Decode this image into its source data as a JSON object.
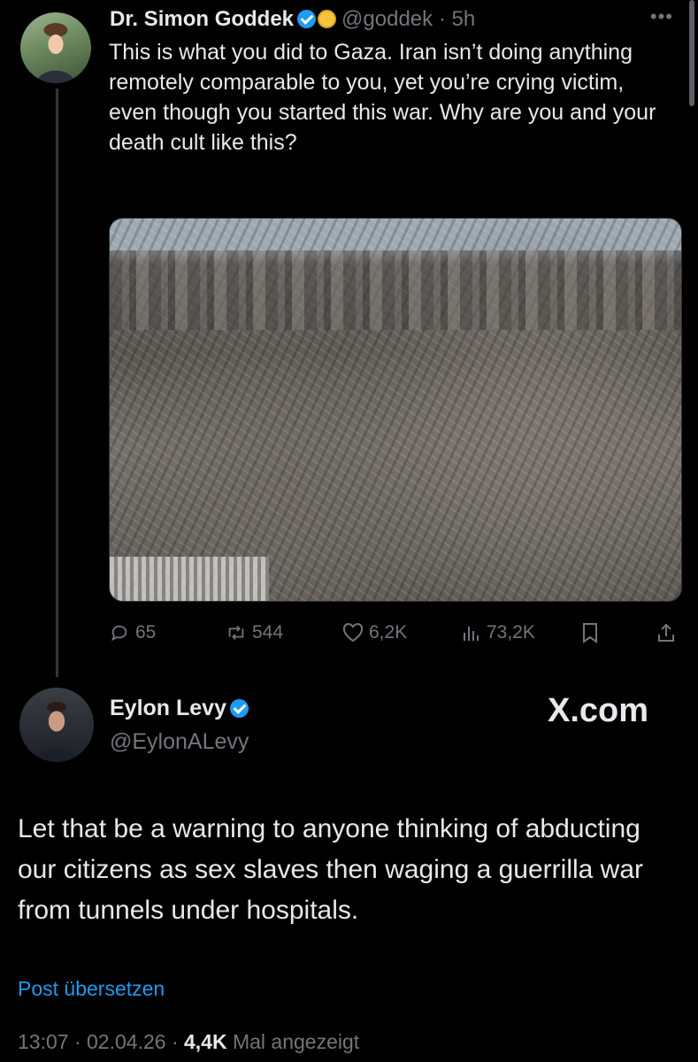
{
  "quoted_post": {
    "author_name": "Dr. Simon Goddek",
    "handle": "@goddek",
    "separator": "·",
    "time": "5h",
    "more_icon": "more-horizontal-icon",
    "text": "This is what you did to Gaza. Iran isn’t doing anything remotely comparable to you, yet you’re crying victim, even though you started this war. Why are you and your death cult like this?",
    "stats": {
      "replies": "65",
      "reposts": "544",
      "likes": "6,2K",
      "views": "73,2K"
    }
  },
  "main_post": {
    "author_name": "Eylon Levy",
    "handle": "@EylonALevy",
    "site_logo": "X.com",
    "text": "Let that be a warning to anyone thinking of abducting our citizens as sex slaves then waging a guerrilla war from tunnels under hospitals.",
    "translate_link": "Post übersetzen",
    "time": "13:07",
    "date": "02.04.26",
    "sep": "·",
    "view_count": "4,4K",
    "views_label": "Mal angezeigt"
  },
  "colors": {
    "background": "#000000",
    "text": "#e7e9ea",
    "muted": "#71767b",
    "accent": "#1d9bf0"
  }
}
